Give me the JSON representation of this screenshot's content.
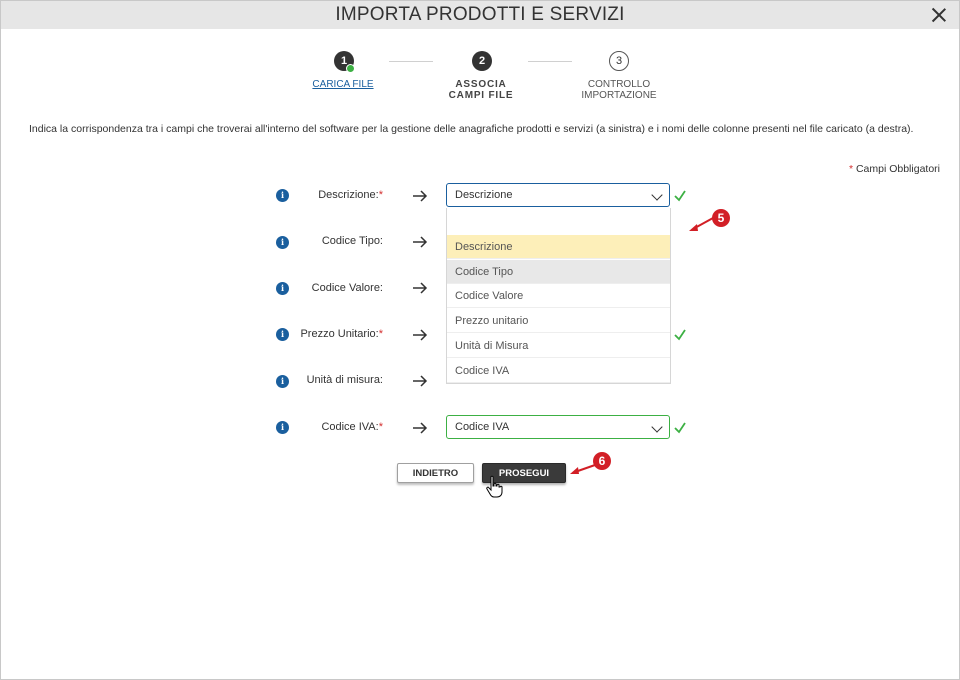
{
  "dialog": {
    "title": "IMPORTA PRODOTTI E SERVIZI"
  },
  "steps": [
    {
      "number": "1",
      "label": "CARICA FILE",
      "state": "completed"
    },
    {
      "number": "2",
      "label_line1": "ASSOCIA",
      "label_line2": "CAMPI FILE",
      "state": "active"
    },
    {
      "number": "3",
      "label_line1": "CONTROLLO",
      "label_line2": "IMPORTAZIONE",
      "state": "pending"
    }
  ],
  "intro_text": "Indica la corrispondenza tra i campi che troverai all'interno del software per la gestione delle anagrafiche prodotti e servizi (a sinistra) e i nomi delle colonne presenti nel file caricato (a destra).",
  "required_note": {
    "star": "*",
    "text": "Campi Obbligatori"
  },
  "fields": [
    {
      "label": "Descrizione:",
      "required": "*",
      "value": "Descrizione"
    },
    {
      "label": "Codice Tipo:",
      "required": "",
      "value": ""
    },
    {
      "label": "Codice Valore:",
      "required": "",
      "value": ""
    },
    {
      "label": "Prezzo Unitario:",
      "required": "*",
      "value": ""
    },
    {
      "label": "Unità di misura:",
      "required": "",
      "value": ""
    },
    {
      "label": "Codice IVA:",
      "required": "*",
      "value": "Codice IVA"
    }
  ],
  "dropdown": {
    "options": [
      "Descrizione",
      "Codice Tipo",
      "Codice Valore",
      "Prezzo unitario",
      "Unità di Misura",
      "Codice IVA"
    ]
  },
  "buttons": {
    "back": "INDIETRO",
    "next": "PROSEGUI"
  },
  "annotations": {
    "badge_5": "5",
    "badge_6": "6",
    "color": "#d21f26"
  },
  "colors": {
    "accent": "#1a5f9e",
    "valid": "#3cb043",
    "required": "#d32f2f",
    "highlight": "#fdefb9"
  }
}
